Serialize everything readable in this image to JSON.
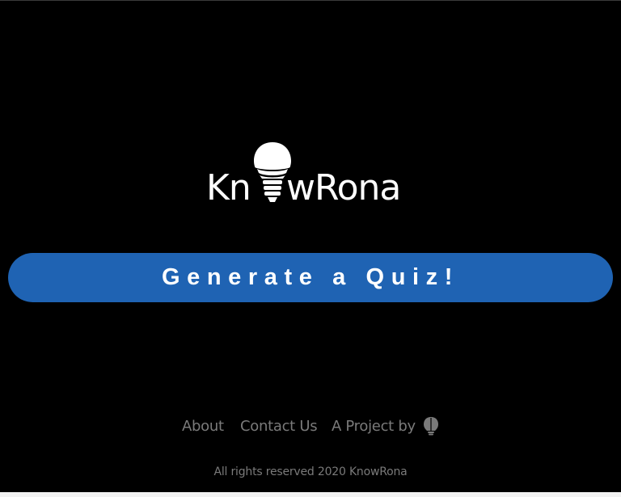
{
  "logo": {
    "text_left": "Kn",
    "text_right": "wRona",
    "icon": "lightbulb-with-mask-icon"
  },
  "main": {
    "quiz_button_label": "Generate a Quiz!"
  },
  "footer": {
    "links": {
      "about": "About",
      "contact": "Contact Us",
      "project": "A Project by"
    },
    "project_icon": "lightbulb-icon",
    "copyright": "All rights reserved 2020 KnowRona"
  },
  "colors": {
    "background": "#000000",
    "button": "#1f63b3",
    "footer_text": "#7a7a7a",
    "logo": "#ffffff"
  }
}
